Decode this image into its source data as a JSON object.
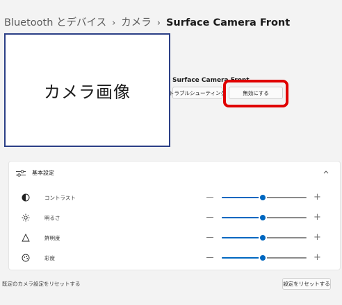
{
  "breadcrumb": {
    "items": [
      "Bluetooth とデバイス",
      "カメラ"
    ],
    "separator": "›",
    "current": "Surface Camera Front"
  },
  "preview": {
    "placeholder": "カメラ画像"
  },
  "camera": {
    "name": "Surface Camera Front",
    "troubleshoot_label": "トラブルシューティング",
    "disable_label": "無効にする"
  },
  "settings": {
    "title": "基本設定",
    "rows": [
      {
        "label": "コントラスト",
        "icon": "contrast-icon",
        "value": 0.48
      },
      {
        "label": "明るさ",
        "icon": "brightness-icon",
        "value": 0.48
      },
      {
        "label": "鮮明度",
        "icon": "sharpness-icon",
        "value": 0.48
      },
      {
        "label": "彩度",
        "icon": "saturation-icon",
        "value": 0.48
      }
    ]
  },
  "reset": {
    "description": "既定のカメラ設定をリセットする",
    "button_label": "設定をリセットする"
  },
  "colors": {
    "accent": "#0067c0",
    "highlight": "#e00000",
    "preview_border": "#2b3f86"
  }
}
